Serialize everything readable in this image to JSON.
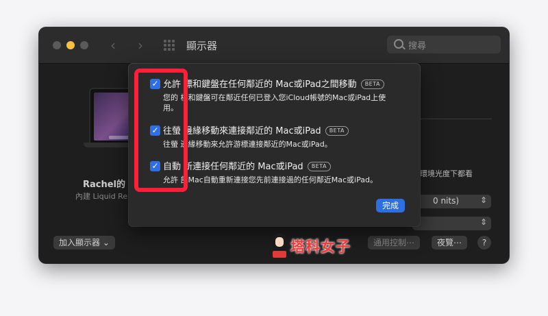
{
  "window": {
    "title": "顯示器",
    "search_placeholder": "搜尋"
  },
  "device": {
    "name": "Rachel的 M",
    "sub": "內建 Liquid Re"
  },
  "right_panel": {
    "ambient_text": "周環境光度下都看",
    "select1_value": "0 nits)",
    "select2_value": ""
  },
  "bottom": {
    "add_display_label": "加入顯示器",
    "common_control_label": "通用控制⋯",
    "night_shift_label": "夜覽⋯",
    "help_label": "?"
  },
  "sheet": {
    "options": [
      {
        "title": "允許 標和鍵盤在任何鄰近的 Mac或iPad之間移動",
        "beta": "BETA",
        "desc": "您的 標和鍵盤可在鄰近任何已登入您iCloud帳號的Mac或iPad上使用。"
      },
      {
        "title": "往螢 邊緣移動來連接鄰近的 Mac或iPad",
        "beta": "BETA",
        "desc": "往螢 邊緣移動來允許游標連接鄰近的Mac或iPad。"
      },
      {
        "title": "自動 新連接任何鄰近的 Mac或iPad",
        "beta": "BETA",
        "desc": "允許 部Mac自動重新連接您先前連接過的任何鄰近Mac或iPad。"
      }
    ],
    "checkmark": "✓",
    "done_label": "完成"
  },
  "watermark": {
    "text": "塔科女子"
  },
  "colors": {
    "accent": "#2d6fe0",
    "annotation": "#ff1f3a",
    "watermark": "#f23a3a"
  }
}
